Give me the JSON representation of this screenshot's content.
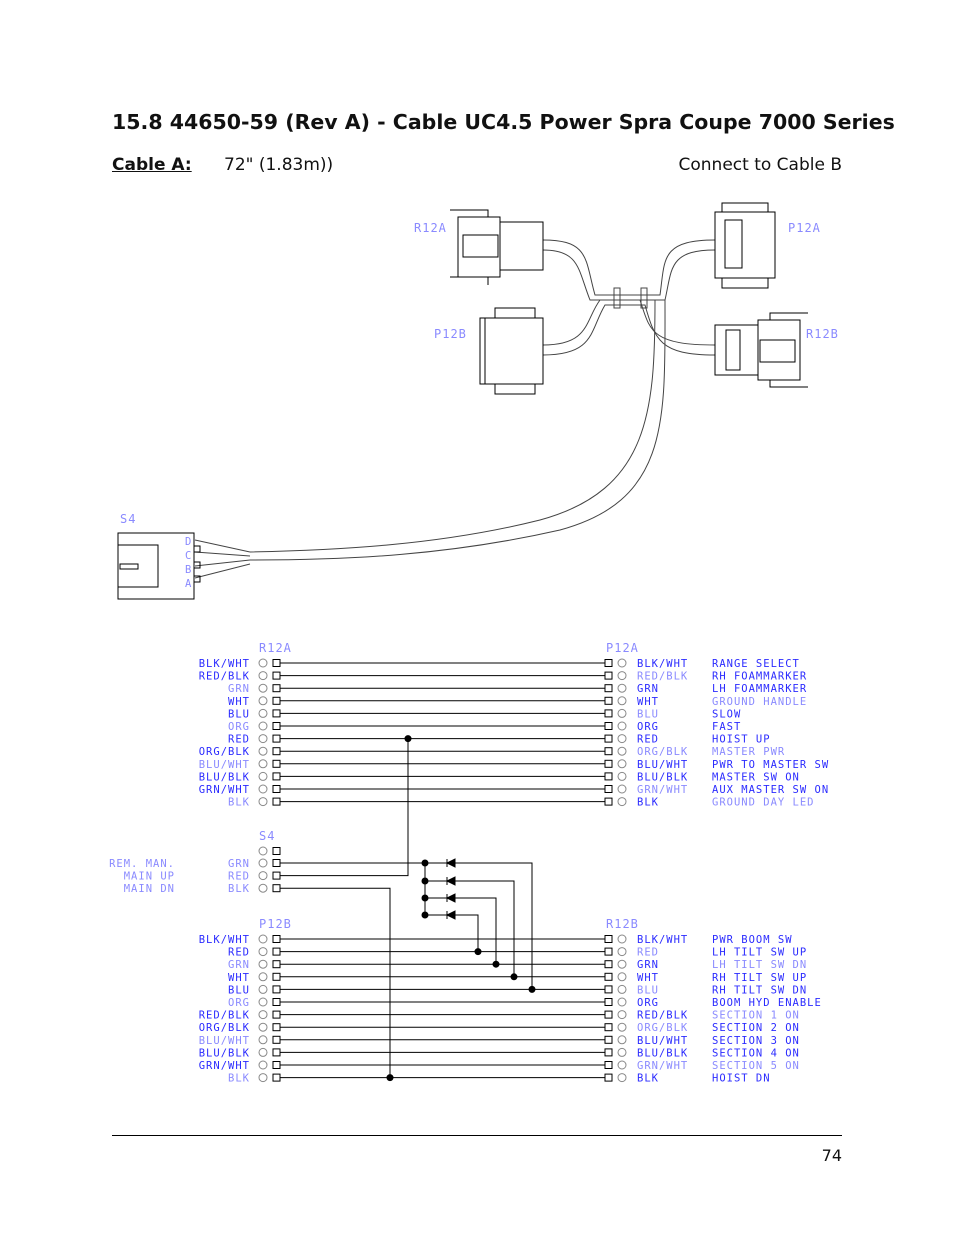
{
  "page": {
    "title": "15.8  44650-59 (Rev A) - Cable UC4.5 Power Spra Coupe 7000 Series",
    "cable_label": "Cable A:",
    "length": "72\" (1.83m))",
    "connect_note": "Connect to Cable B",
    "page_number": "74"
  },
  "drawing": {
    "connectors": {
      "r12a": "R12A",
      "p12a": "P12A",
      "p12b": "P12B",
      "r12b": "R12B",
      "s4": "S4"
    },
    "s4_pins": [
      "D",
      "C",
      "B",
      "A"
    ]
  },
  "schematic": {
    "r12a": {
      "name": "R12A",
      "wires": [
        "BLK/WHT",
        "RED/BLK",
        "GRN",
        "WHT",
        "BLU",
        "ORG",
        "RED",
        "ORG/BLK",
        "BLU/WHT",
        "BLU/BLK",
        "GRN/WHT",
        "BLK"
      ]
    },
    "p12a": {
      "name": "P12A",
      "wires": [
        "BLK/WHT",
        "RED/BLK",
        "GRN",
        "WHT",
        "BLU",
        "ORG",
        "RED",
        "ORG/BLK",
        "BLU/WHT",
        "BLU/BLK",
        "GRN/WHT",
        "BLK"
      ],
      "functions": [
        "RANGE SELECT",
        "RH FOAMMARKER",
        "LH FOAMMARKER",
        "GROUND HANDLE",
        "SLOW",
        "FAST",
        "HOIST UP",
        "MASTER PWR",
        "PWR TO MASTER SW",
        "MASTER SW ON",
        "AUX MASTER SW ON",
        "GROUND DAY LED"
      ]
    },
    "s4": {
      "name": "S4",
      "wires": [
        "GRN",
        "RED",
        "BLK"
      ],
      "functions": [
        "REM. MAN.",
        "MAIN UP",
        "MAIN DN"
      ]
    },
    "p12b": {
      "name": "P12B",
      "wires": [
        "BLK/WHT",
        "RED",
        "GRN",
        "WHT",
        "BLU",
        "ORG",
        "RED/BLK",
        "ORG/BLK",
        "BLU/WHT",
        "BLU/BLK",
        "GRN/WHT",
        "BLK"
      ]
    },
    "r12b": {
      "name": "R12B",
      "wires": [
        "BLK/WHT",
        "RED",
        "GRN",
        "WHT",
        "BLU",
        "ORG",
        "RED/BLK",
        "ORG/BLK",
        "BLU/WHT",
        "BLU/BLK",
        "GRN/WHT",
        "BLK"
      ],
      "functions": [
        "PWR BOOM SW",
        "LH TILT SW UP",
        "LH TILT SW DN",
        "RH TILT SW UP",
        "RH TILT SW DN",
        "BOOM HYD ENABLE",
        "SECTION 1 ON",
        "SECTION 2 ON",
        "SECTION 3 ON",
        "SECTION 4 ON",
        "SECTION 5 ON",
        "HOIST DN"
      ]
    }
  }
}
